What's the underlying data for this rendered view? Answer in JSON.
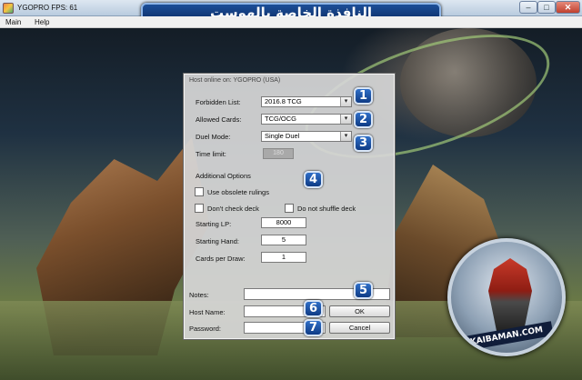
{
  "window": {
    "title": "YGOPRO FPS: 61",
    "banner": "النافذة الخاصة بالهوست",
    "min_glyph": "–",
    "max_glyph": "□",
    "close_glyph": "✕"
  },
  "menu": [
    "Main",
    "Help"
  ],
  "dialog": {
    "title": "Host online on: YGOPRO (USA)",
    "forbidden_list": {
      "label": "Forbidden List:",
      "value": "2016.8 TCG"
    },
    "allowed_cards": {
      "label": "Allowed Cards:",
      "value": "TCG/OCG"
    },
    "duel_mode": {
      "label": "Duel Mode:",
      "value": "Single Duel"
    },
    "time_limit": {
      "label": "Time limit:",
      "value": "180"
    },
    "additional_options": "Additional Options",
    "use_obsolete_rulings": "Use obsolete rulings",
    "dont_check_deck": "Don't check deck",
    "do_not_shuffle_deck": "Do not shuffle deck",
    "starting_lp": {
      "label": "Starting LP:",
      "value": "8000"
    },
    "starting_hand": {
      "label": "Starting Hand:",
      "value": "5"
    },
    "cards_per_draw": {
      "label": "Cards per Draw:",
      "value": "1"
    },
    "notes_label": "Notes:",
    "host_name_label": "Host Name:",
    "password_label": "Password:",
    "ok_label": "OK",
    "cancel_label": "Cancel",
    "dropdown_arrow": "▾"
  },
  "badges": [
    "1",
    "2",
    "3",
    "4",
    "5",
    "6",
    "7"
  ],
  "logo_text": "KAIBAMAN.COM"
}
